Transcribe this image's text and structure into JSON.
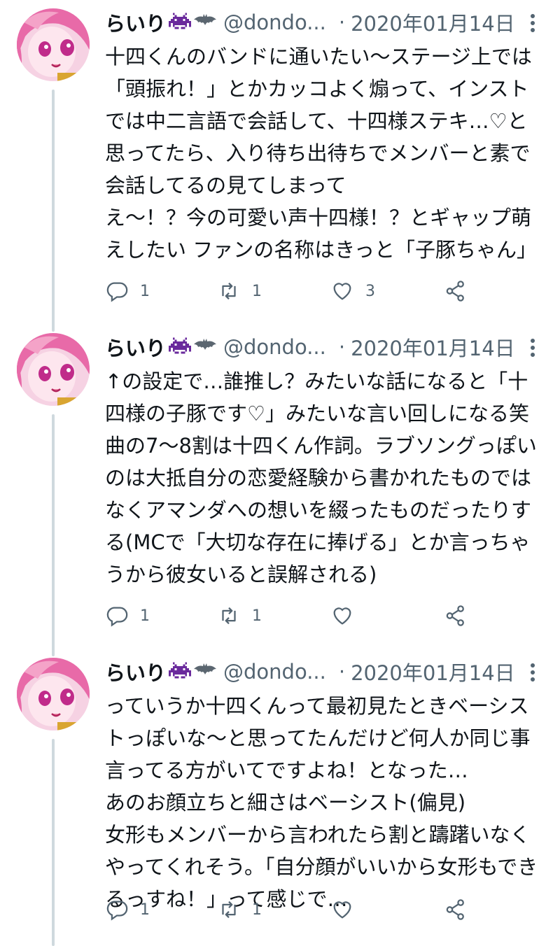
{
  "tweets": [
    {
      "display_name": "らいり",
      "handle": "@dondo...",
      "separator": "·",
      "date": "2020年01月14日",
      "text": "十四くんのバンドに通いたい〜ステージ上では「頭振れ！」とかカッコよく煽って、インストでは中二言語で会話して、十四様ステキ…♡と思ってたら、入り待ち出待ちでメンバーと素で会話してるの見てしまって\nえ〜！？今の可愛い声十四様！？とギャップ萌えしたい ファンの名称はきっと「子豚ちゃん」",
      "reply_count": "1",
      "retweet_count": "1",
      "like_count": "3"
    },
    {
      "display_name": "らいり",
      "handle": "@dondo...",
      "separator": "·",
      "date": "2020年01月14日",
      "text": "↑の設定で…誰推し？みたいな話になると「十四様の子豚です♡」みたいな言い回しになる笑\n曲の7〜8割は十四くん作詞。ラブソングっぽいのは大抵自分の恋愛経験から書かれたものではなくアマンダへの想いを綴ったものだったりする(MCで「大切な存在に捧げる」とか言っちゃうから彼女いると誤解される)",
      "reply_count": "1",
      "retweet_count": "1",
      "like_count": ""
    },
    {
      "display_name": "らいり",
      "handle": "@dondo...",
      "separator": "·",
      "date": "2020年01月14日",
      "text": "っていうか十四くんって最初見たときベーシストっぽいな〜と思ってたんだけど何人か同じ事言ってる方がいてですよね！となった…\nあのお顔立ちと細さはベーシスト(偏見)\n女形もメンバーから言われたら割と躊躇いなくやってくれそう。「自分顔がいいから女形もできるっすね！」って感じで…",
      "reply_count": "1",
      "retweet_count": "1",
      "like_count": ""
    }
  ],
  "icons": {
    "name_emoji_1": "space-invader-icon",
    "name_emoji_2": "bat-icon",
    "reply": "reply-icon",
    "retweet": "retweet-icon",
    "like": "heart-icon",
    "share": "share-icon",
    "more": "more-vertical-icon"
  },
  "colors": {
    "text": "#0f1419",
    "secondary": "#536471",
    "thread_line": "#cfd9de",
    "emoji_purple": "#6a2a9c",
    "bat_gray": "#5b6670"
  }
}
